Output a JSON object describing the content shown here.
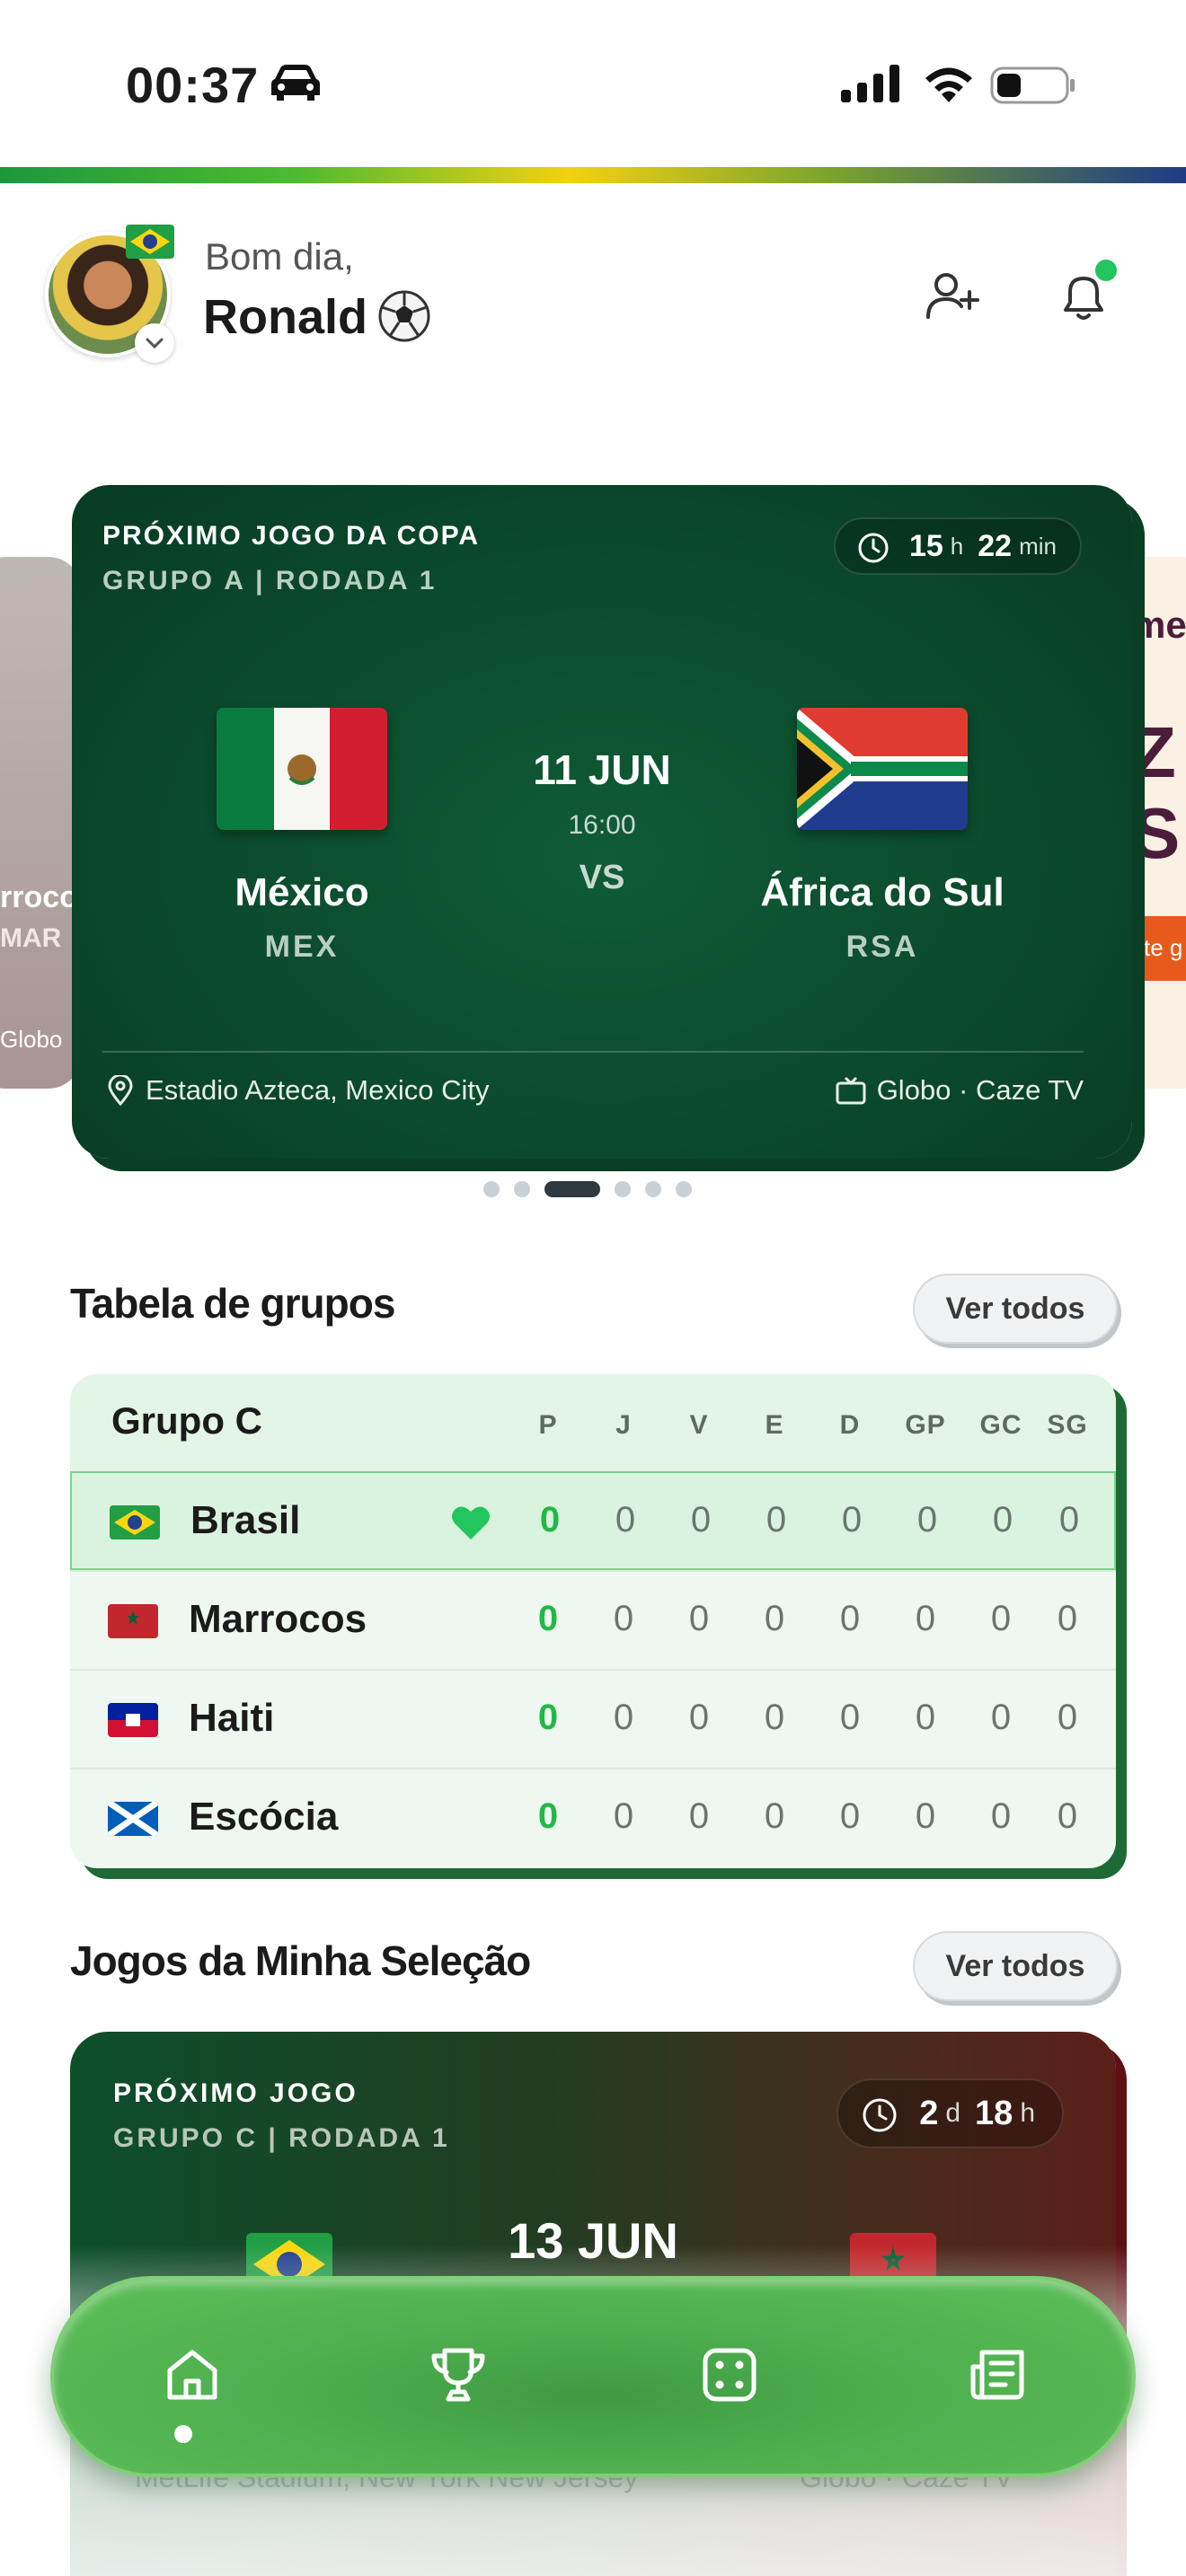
{
  "status_bar": {
    "time": "00:37",
    "icons": [
      "car-icon",
      "signal-icon",
      "wifi-icon",
      "battery-icon"
    ]
  },
  "header": {
    "greeting": "Bom dia,",
    "user_name": "Ronald",
    "icons": [
      "avatar",
      "brazil-flag-icon",
      "chevron-down-icon",
      "soccer-ball-icon",
      "add-friend-icon",
      "bell-icon"
    ],
    "notification_dot_color": "#22c55e"
  },
  "featured_match": {
    "title": "PRÓXIMO JOGO DA COPA",
    "subtitle": "GRUPO A | RODADA 1",
    "countdown": {
      "hours": "15",
      "hours_unit": "h",
      "minutes": "22",
      "minutes_unit": "min"
    },
    "home": {
      "name": "México",
      "code": "MEX",
      "flag": "mexico-flag-icon"
    },
    "away": {
      "name": "África do Sul",
      "code": "RSA",
      "flag": "south-africa-flag-icon"
    },
    "date": "11 JUN",
    "time": "16:00",
    "vs": "VS",
    "venue": "Estadio Azteca, Mexico City",
    "broadcasters": "Globo · Caze TV"
  },
  "carousel": {
    "left_peek": {
      "line1": "rroco",
      "line2": "MAR",
      "footer": "Globo"
    },
    "right_peek": {
      "line1": "me",
      "line2": "Z",
      "line3": "S",
      "button": "ste g"
    },
    "pages": 6,
    "active_page": 3
  },
  "groups_section": {
    "title": "Tabela de grupos",
    "see_all": "Ver todos",
    "group_name": "Grupo C",
    "columns": [
      "P",
      "J",
      "V",
      "E",
      "D",
      "GP",
      "GC",
      "SG"
    ],
    "rows": [
      {
        "team": "Brasil",
        "flag": "brazil-flag-icon",
        "favorite": true,
        "stats": [
          "0",
          "0",
          "0",
          "0",
          "0",
          "0",
          "0",
          "0"
        ]
      },
      {
        "team": "Marrocos",
        "flag": "morocco-flag-icon",
        "favorite": false,
        "stats": [
          "0",
          "0",
          "0",
          "0",
          "0",
          "0",
          "0",
          "0"
        ]
      },
      {
        "team": "Haiti",
        "flag": "haiti-flag-icon",
        "favorite": false,
        "stats": [
          "0",
          "0",
          "0",
          "0",
          "0",
          "0",
          "0",
          "0"
        ]
      },
      {
        "team": "Escócia",
        "flag": "scotland-flag-icon",
        "favorite": false,
        "stats": [
          "0",
          "0",
          "0",
          "0",
          "0",
          "0",
          "0",
          "0"
        ]
      }
    ]
  },
  "my_team_section": {
    "title": "Jogos da Minha Seleção",
    "see_all": "Ver todos",
    "card": {
      "title": "PRÓXIMO JOGO",
      "subtitle": "GRUPO C | RODADA 1",
      "countdown": {
        "days": "2",
        "days_unit": "d",
        "hours": "18",
        "hours_unit": "h"
      },
      "date": "13 JUN",
      "home_flag": "brazil-flag-icon",
      "away_flag": "morocco-flag-icon",
      "venue": "MetLife Stadium, New York New Jersey",
      "broadcasters": "Globo · Caze TV"
    }
  },
  "bottom_nav": {
    "items": [
      "home-icon",
      "trophy-icon",
      "dice-icon",
      "news-icon"
    ],
    "active": "home-icon"
  },
  "colors": {
    "card_green": "#0b4a2c",
    "accent_green": "#22b847",
    "nav_green": "#4fb04f",
    "stripe": [
      "#1a9a3d",
      "#f4d10f",
      "#1d3b86"
    ]
  }
}
